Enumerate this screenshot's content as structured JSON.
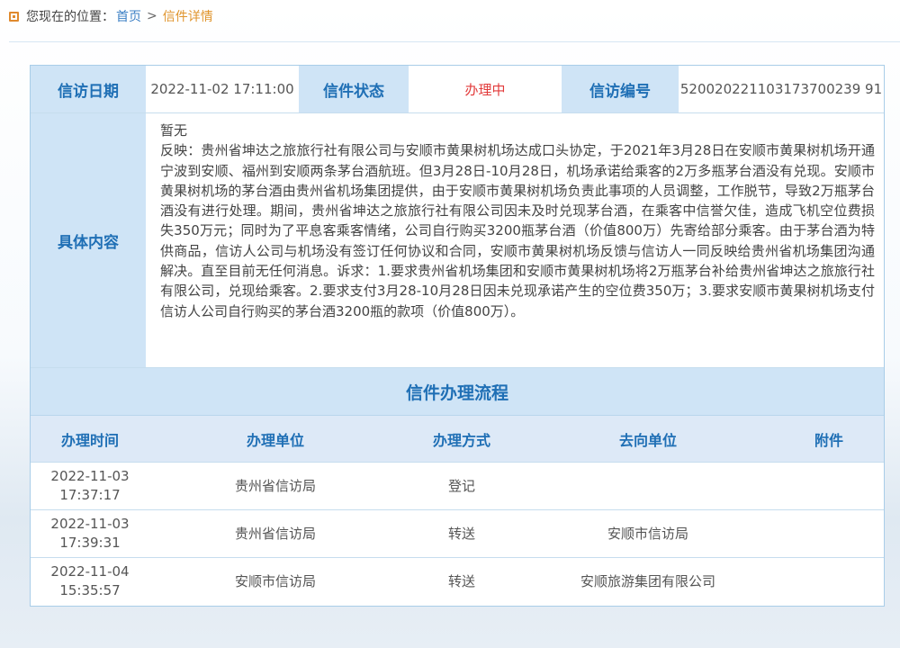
{
  "breadcrumb": {
    "prefix": "您现在的位置：",
    "home": "首页",
    "separator": ">",
    "current": "信件详情"
  },
  "letter": {
    "date_label": "信访日期",
    "date_value": "2022-11-02 17:11:00",
    "status_label": "信件状态",
    "status_value": "办理中",
    "number_label": "信访编号",
    "number_value": "520020221103173700239 91",
    "content_label": "具体内容",
    "content_title": "暂无",
    "content_body": "反映：贵州省坤达之旅旅行社有限公司与安顺市黄果树机场达成口头协定，于2021年3月28日在安顺市黄果树机场开通宁波到安顺、福州到安顺两条茅台酒航班。但3月28日-10月28日，机场承诺给乘客的2万多瓶茅台酒没有兑现。安顺市黄果树机场的茅台酒由贵州省机场集团提供，由于安顺市黄果树机场负责此事项的人员调整，工作脱节，导致2万瓶茅台酒没有进行处理。期间，贵州省坤达之旅旅行社有限公司因未及时兑现茅台酒，在乘客中信誉欠佳，造成飞机空位费损失350万元；同时为了平息客乘客情绪，公司自行购买3200瓶茅台酒（价值800万）先寄给部分乘客。由于茅台酒为特供商品，信访人公司与机场没有签订任何协议和合同，安顺市黄果树机场反馈与信访人一同反映给贵州省机场集团沟通解决。直至目前无任何消息。诉求：1.要求贵州省机场集团和安顺市黄果树机场将2万瓶茅台补给贵州省坤达之旅旅行社有限公司，兑现给乘客。2.要求支付3月28-10月28日因未兑现承诺产生的空位费350万；3.要求安顺市黄果树机场支付信访人公司自行购买的茅台酒3200瓶的款项（价值800万）。"
  },
  "flow": {
    "title": "信件办理流程",
    "headers": [
      "办理时间",
      "办理单位",
      "办理方式",
      "去向单位",
      "附件"
    ],
    "rows": [
      {
        "date": "2022-11-03",
        "time": "17:37:17",
        "unit": "贵州省信访局",
        "method": "登记",
        "target": "",
        "attachment": ""
      },
      {
        "date": "2022-11-03",
        "time": "17:39:31",
        "unit": "贵州省信访局",
        "method": "转送",
        "target": "安顺市信访局",
        "attachment": ""
      },
      {
        "date": "2022-11-04",
        "time": "15:35:57",
        "unit": "安顺市信访局",
        "method": "转送",
        "target": "安顺旅游集团有限公司",
        "attachment": ""
      }
    ]
  }
}
